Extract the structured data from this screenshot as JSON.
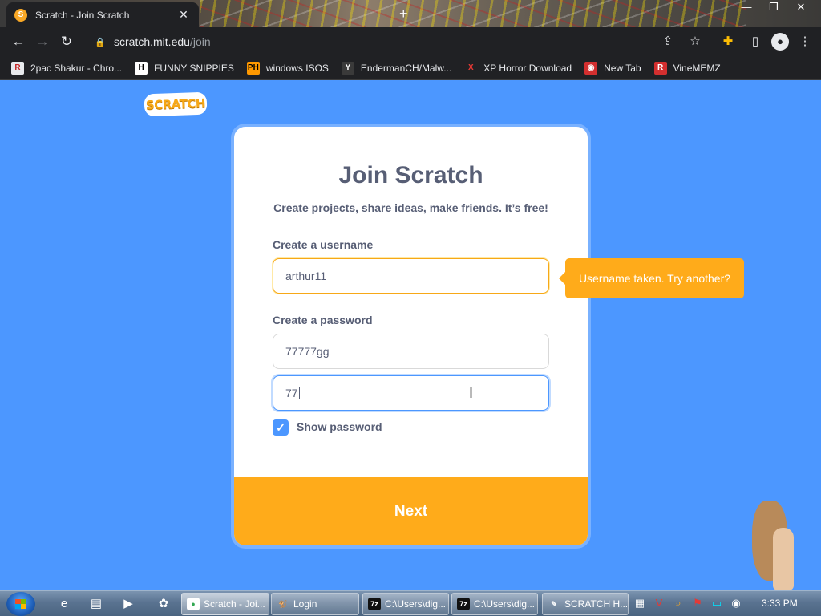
{
  "browser": {
    "tab_title": "Scratch - Join Scratch",
    "tab_close": "✕",
    "new_tab": "+",
    "window_buttons": [
      "—",
      "❐",
      "✕"
    ],
    "url_host": "scratch.mit.edu",
    "url_path": "/join",
    "bookmarks": [
      {
        "label": "2pac Shakur - Chro...",
        "icon": "R",
        "icon_bg": "#e8eaed",
        "icon_fg": "#c62828"
      },
      {
        "label": "FUNNY SNIPPIES",
        "icon": "H",
        "icon_bg": "#ffffff",
        "icon_fg": "#000000"
      },
      {
        "label": "windows ISOS",
        "icon": "PH",
        "icon_bg": "#ff9900",
        "icon_fg": "#000000"
      },
      {
        "label": "EndermanCH/Malw...",
        "icon": "Y",
        "icon_bg": "#3a3a3a",
        "icon_fg": "#ffffff"
      },
      {
        "label": "XP Horror Download",
        "icon": "X",
        "icon_bg": "#202124",
        "icon_fg": "#e53935"
      },
      {
        "label": "New Tab",
        "icon": "◉",
        "icon_bg": "#d32f2f",
        "icon_fg": "#ffffff"
      },
      {
        "label": "VineMEMZ",
        "icon": "R",
        "icon_bg": "#d32f2f",
        "icon_fg": "#ffffff"
      }
    ]
  },
  "page": {
    "logo": "SCRATCH",
    "title": "Join Scratch",
    "subtitle": "Create projects, share ideas, make friends. It’s free!",
    "username_label": "Create a username",
    "username_value": "arthur11",
    "username_tooltip": "Username taken. Try another?",
    "password_label": "Create a password",
    "password_value": "77777gg",
    "confirm_value": "77",
    "show_password_label": "Show password",
    "show_password_checked": true,
    "next_button": "Next"
  },
  "taskbar": {
    "tasks": [
      {
        "label": "Scratch - Joi...",
        "icon": "●",
        "icon_bg": "#ffffff",
        "icon_fg": "#34a853",
        "active": true
      },
      {
        "label": "Login",
        "icon": "🐒",
        "icon_bg": "transparent",
        "icon_fg": "#ffffff",
        "active": false
      },
      {
        "label": "C:\\Users\\dig...",
        "icon": "7z",
        "icon_bg": "#111111",
        "icon_fg": "#ffffff",
        "active": false
      },
      {
        "label": "C:\\Users\\dig...",
        "icon": "7z",
        "icon_bg": "#111111",
        "icon_fg": "#ffffff",
        "active": false
      },
      {
        "label": "SCRATCH H...",
        "icon": "✎",
        "icon_bg": "transparent",
        "icon_fg": "#ffffff",
        "active": false
      }
    ],
    "clock": "3:33 PM"
  },
  "colors": {
    "page_bg": "#4c97ff",
    "accent_orange": "#ffab1a",
    "text_grey": "#575e75"
  }
}
